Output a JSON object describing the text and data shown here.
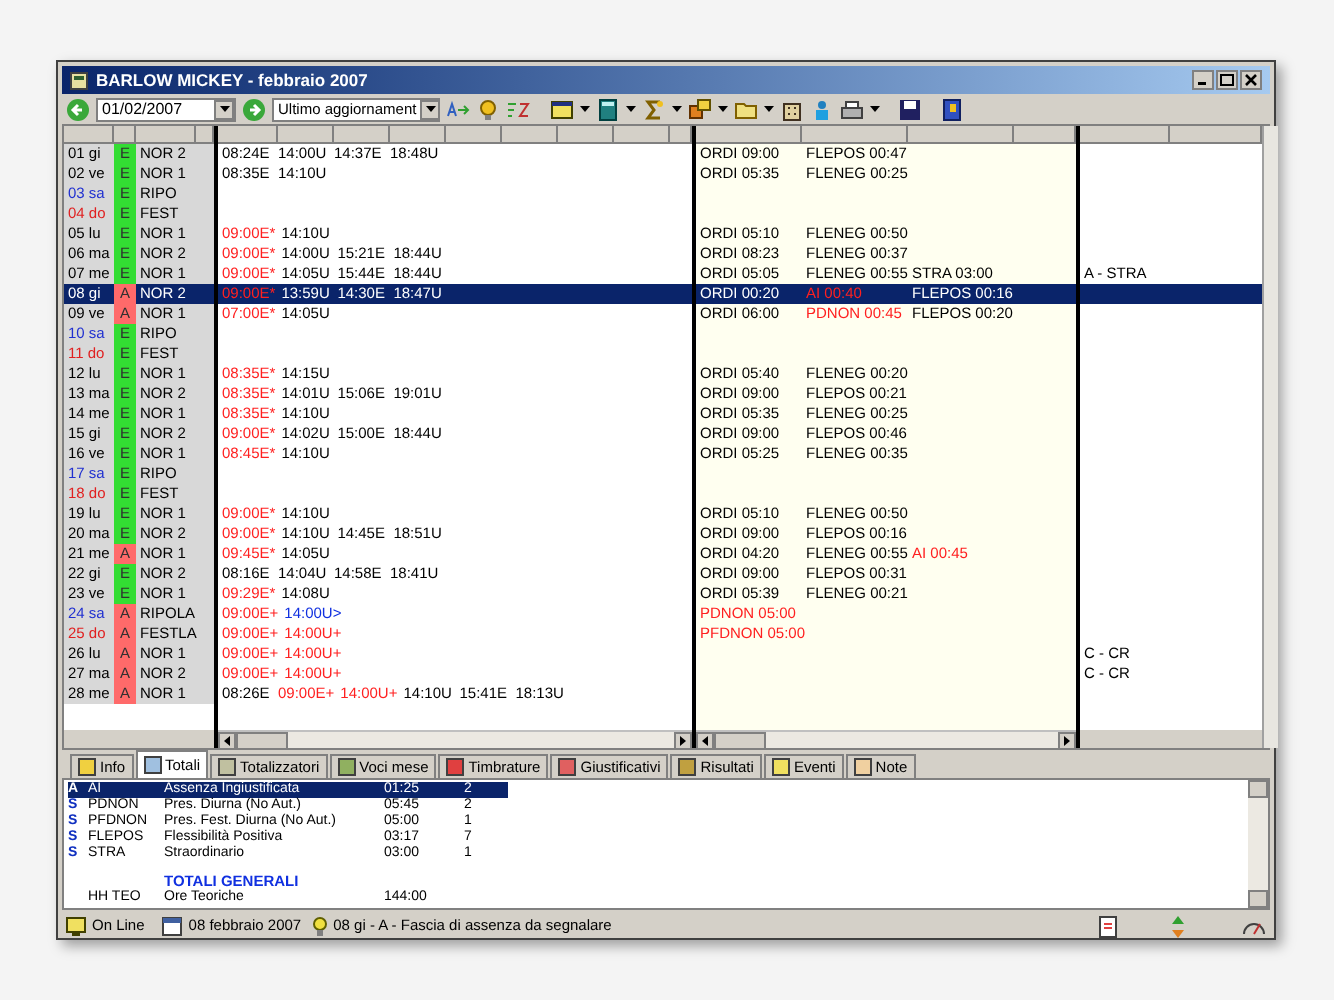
{
  "window": {
    "title": "BARLOW MICKEY - febbraio 2007"
  },
  "toolbar": {
    "date": "01/02/2007",
    "view": "Ultimo aggiornament"
  },
  "rows": [
    {
      "day": {
        "text": "01 gi",
        "color": "#000000"
      },
      "flag": {
        "text": "E",
        "color": "#33dd33"
      },
      "shift": "NOR 2",
      "selected": false,
      "times": [
        {
          "text": "08:24E",
          "kind": "normal"
        },
        {
          "text": "14:00U",
          "kind": "normal"
        },
        {
          "text": "14:37E",
          "kind": "normal"
        },
        {
          "text": "18:48U",
          "kind": "normal"
        }
      ],
      "results": [
        {
          "text": "ORDI 09:00",
          "kind": "normal"
        },
        {
          "text": "FLEPOS 00:47",
          "kind": "normal"
        }
      ]
    },
    {
      "day": {
        "text": "02 ve",
        "color": "#000000"
      },
      "flag": {
        "text": "E",
        "color": "#33dd33"
      },
      "shift": "NOR 1",
      "selected": false,
      "times": [
        {
          "text": "08:35E",
          "kind": "normal"
        },
        {
          "text": "14:10U",
          "kind": "normal"
        }
      ],
      "results": [
        {
          "text": "ORDI 05:35",
          "kind": "normal"
        },
        {
          "text": "FLENEG 00:25",
          "kind": "normal"
        }
      ]
    },
    {
      "day": {
        "text": "03 sa",
        "color": "#2030d0"
      },
      "flag": {
        "text": "E",
        "color": "#33dd33"
      },
      "shift": "RIPO",
      "selected": false,
      "times": [],
      "results": []
    },
    {
      "day": {
        "text": "04 do",
        "color": "#e02020"
      },
      "flag": {
        "text": "E",
        "color": "#33dd33"
      },
      "shift": "FEST",
      "selected": false,
      "times": [],
      "results": []
    },
    {
      "day": {
        "text": "05 lu",
        "color": "#000000"
      },
      "flag": {
        "text": "E",
        "color": "#33dd33"
      },
      "shift": "NOR 1",
      "selected": false,
      "times": [
        {
          "text": "09:00E*",
          "kind": "anomaly"
        },
        {
          "text": "14:10U",
          "kind": "normal"
        }
      ],
      "results": [
        {
          "text": "ORDI 05:10",
          "kind": "normal"
        },
        {
          "text": "FLENEG 00:50",
          "kind": "normal"
        }
      ]
    },
    {
      "day": {
        "text": "06 ma",
        "color": "#000000"
      },
      "flag": {
        "text": "E",
        "color": "#33dd33"
      },
      "shift": "NOR 2",
      "selected": false,
      "times": [
        {
          "text": "09:00E*",
          "kind": "anomaly"
        },
        {
          "text": "14:00U",
          "kind": "normal"
        },
        {
          "text": "15:21E",
          "kind": "normal"
        },
        {
          "text": "18:44U",
          "kind": "normal"
        }
      ],
      "results": [
        {
          "text": "ORDI 08:23",
          "kind": "normal"
        },
        {
          "text": "FLENEG 00:37",
          "kind": "normal"
        }
      ]
    },
    {
      "day": {
        "text": "07 me",
        "color": "#000000"
      },
      "flag": {
        "text": "E",
        "color": "#33dd33"
      },
      "shift": "NOR 1",
      "selected": false,
      "times": [
        {
          "text": "09:00E*",
          "kind": "anomaly"
        },
        {
          "text": "14:05U",
          "kind": "normal"
        },
        {
          "text": "15:44E",
          "kind": "normal"
        },
        {
          "text": "18:44U",
          "kind": "normal"
        }
      ],
      "results": [
        {
          "text": "ORDI 05:05",
          "kind": "normal"
        },
        {
          "text": "FLENEG 00:55",
          "kind": "normal"
        },
        {
          "text": "STRA 03:00",
          "kind": "normal"
        }
      ],
      "note": "A - STRA"
    },
    {
      "day": {
        "text": "08 gi"
      },
      "flag": {
        "text": "A",
        "color": "#ff6a6a"
      },
      "shift": "NOR 2",
      "selected": true,
      "times": [
        {
          "text": "09:00E*",
          "kind": "anomaly"
        },
        {
          "text": "13:59U",
          "kind": "normal"
        },
        {
          "text": "14:30E",
          "kind": "normal"
        },
        {
          "text": "18:47U",
          "kind": "normal"
        }
      ],
      "results": [
        {
          "text": "ORDI 00:20",
          "kind": "normal"
        },
        {
          "text": "AI 00:40",
          "kind": "anomaly"
        },
        {
          "text": "FLEPOS 00:16",
          "kind": "normal"
        }
      ]
    },
    {
      "day": {
        "text": "09 ve",
        "color": "#000000"
      },
      "flag": {
        "text": "A",
        "color": "#ff6a6a"
      },
      "shift": "NOR 1",
      "selected": false,
      "times": [
        {
          "text": "07:00E*",
          "kind": "anomaly"
        },
        {
          "text": "14:05U",
          "kind": "normal"
        }
      ],
      "results": [
        {
          "text": "ORDI 06:00",
          "kind": "normal"
        },
        {
          "text": "PDNON 00:45",
          "kind": "anomaly"
        },
        {
          "text": "FLEPOS 00:20",
          "kind": "normal"
        }
      ]
    },
    {
      "day": {
        "text": "10 sa",
        "color": "#2030d0"
      },
      "flag": {
        "text": "E",
        "color": "#33dd33"
      },
      "shift": "RIPO",
      "selected": false,
      "times": [],
      "results": []
    },
    {
      "day": {
        "text": "11 do",
        "color": "#e02020"
      },
      "flag": {
        "text": "E",
        "color": "#33dd33"
      },
      "shift": "FEST",
      "selected": false,
      "times": [],
      "results": []
    },
    {
      "day": {
        "text": "12 lu",
        "color": "#000000"
      },
      "flag": {
        "text": "E",
        "color": "#33dd33"
      },
      "shift": "NOR 1",
      "selected": false,
      "times": [
        {
          "text": "08:35E*",
          "kind": "anomaly"
        },
        {
          "text": "14:15U",
          "kind": "normal"
        }
      ],
      "results": [
        {
          "text": "ORDI 05:40",
          "kind": "normal"
        },
        {
          "text": "FLENEG 00:20",
          "kind": "normal"
        }
      ]
    },
    {
      "day": {
        "text": "13 ma",
        "color": "#000000"
      },
      "flag": {
        "text": "E",
        "color": "#33dd33"
      },
      "shift": "NOR 2",
      "selected": false,
      "times": [
        {
          "text": "08:35E*",
          "kind": "anomaly"
        },
        {
          "text": "14:01U",
          "kind": "normal"
        },
        {
          "text": "15:06E",
          "kind": "normal"
        },
        {
          "text": "19:01U",
          "kind": "normal"
        }
      ],
      "results": [
        {
          "text": "ORDI 09:00",
          "kind": "normal"
        },
        {
          "text": "FLEPOS 00:21",
          "kind": "normal"
        }
      ]
    },
    {
      "day": {
        "text": "14 me",
        "color": "#000000"
      },
      "flag": {
        "text": "E",
        "color": "#33dd33"
      },
      "shift": "NOR 1",
      "selected": false,
      "times": [
        {
          "text": "08:35E*",
          "kind": "anomaly"
        },
        {
          "text": "14:10U",
          "kind": "normal"
        }
      ],
      "results": [
        {
          "text": "ORDI 05:35",
          "kind": "normal"
        },
        {
          "text": "FLENEG 00:25",
          "kind": "normal"
        }
      ]
    },
    {
      "day": {
        "text": "15 gi",
        "color": "#000000"
      },
      "flag": {
        "text": "E",
        "color": "#33dd33"
      },
      "shift": "NOR 2",
      "selected": false,
      "times": [
        {
          "text": "09:00E*",
          "kind": "anomaly"
        },
        {
          "text": "14:02U",
          "kind": "normal"
        },
        {
          "text": "15:00E",
          "kind": "normal"
        },
        {
          "text": "18:44U",
          "kind": "normal"
        }
      ],
      "results": [
        {
          "text": "ORDI 09:00",
          "kind": "normal"
        },
        {
          "text": "FLEPOS 00:46",
          "kind": "normal"
        }
      ]
    },
    {
      "day": {
        "text": "16 ve",
        "color": "#000000"
      },
      "flag": {
        "text": "E",
        "color": "#33dd33"
      },
      "shift": "NOR 1",
      "selected": false,
      "times": [
        {
          "text": "08:45E*",
          "kind": "anomaly"
        },
        {
          "text": "14:10U",
          "kind": "normal"
        }
      ],
      "results": [
        {
          "text": "ORDI 05:25",
          "kind": "normal"
        },
        {
          "text": "FLENEG 00:35",
          "kind": "normal"
        }
      ]
    },
    {
      "day": {
        "text": "17 sa",
        "color": "#2030d0"
      },
      "flag": {
        "text": "E",
        "color": "#33dd33"
      },
      "shift": "RIPO",
      "selected": false,
      "times": [],
      "results": []
    },
    {
      "day": {
        "text": "18 do",
        "color": "#e02020"
      },
      "flag": {
        "text": "E",
        "color": "#33dd33"
      },
      "shift": "FEST",
      "selected": false,
      "times": [],
      "results": []
    },
    {
      "day": {
        "text": "19 lu",
        "color": "#000000"
      },
      "flag": {
        "text": "E",
        "color": "#33dd33"
      },
      "shift": "NOR 1",
      "selected": false,
      "times": [
        {
          "text": "09:00E*",
          "kind": "anomaly"
        },
        {
          "text": "14:10U",
          "kind": "normal"
        }
      ],
      "results": [
        {
          "text": "ORDI 05:10",
          "kind": "normal"
        },
        {
          "text": "FLENEG 00:50",
          "kind": "normal"
        }
      ]
    },
    {
      "day": {
        "text": "20 ma",
        "color": "#000000"
      },
      "flag": {
        "text": "E",
        "color": "#33dd33"
      },
      "shift": "NOR 2",
      "selected": false,
      "times": [
        {
          "text": "09:00E*",
          "kind": "anomaly"
        },
        {
          "text": "14:10U",
          "kind": "normal"
        },
        {
          "text": "14:45E",
          "kind": "normal"
        },
        {
          "text": "18:51U",
          "kind": "normal"
        }
      ],
      "results": [
        {
          "text": "ORDI 09:00",
          "kind": "normal"
        },
        {
          "text": "FLEPOS 00:16",
          "kind": "normal"
        }
      ]
    },
    {
      "day": {
        "text": "21 me",
        "color": "#000000"
      },
      "flag": {
        "text": "A",
        "color": "#ff6a6a"
      },
      "shift": "NOR 1",
      "selected": false,
      "times": [
        {
          "text": "09:45E*",
          "kind": "anomaly"
        },
        {
          "text": "14:05U",
          "kind": "normal"
        }
      ],
      "results": [
        {
          "text": "ORDI 04:20",
          "kind": "normal"
        },
        {
          "text": "FLENEG 00:55",
          "kind": "normal"
        },
        {
          "text": "AI 00:45",
          "kind": "anomaly"
        }
      ]
    },
    {
      "day": {
        "text": "22 gi",
        "color": "#000000"
      },
      "flag": {
        "text": "E",
        "color": "#33dd33"
      },
      "shift": "NOR 2",
      "selected": false,
      "times": [
        {
          "text": "08:16E",
          "kind": "normal"
        },
        {
          "text": "14:04U",
          "kind": "normal"
        },
        {
          "text": "14:58E",
          "kind": "normal"
        },
        {
          "text": "18:41U",
          "kind": "normal"
        }
      ],
      "results": [
        {
          "text": "ORDI 09:00",
          "kind": "normal"
        },
        {
          "text": "FLEPOS 00:31",
          "kind": "normal"
        }
      ]
    },
    {
      "day": {
        "text": "23 ve",
        "color": "#000000"
      },
      "flag": {
        "text": "E",
        "color": "#33dd33"
      },
      "shift": "NOR 1",
      "selected": false,
      "times": [
        {
          "text": "09:29E*",
          "kind": "anomaly"
        },
        {
          "text": "14:08U",
          "kind": "normal"
        }
      ],
      "results": [
        {
          "text": "ORDI 05:39",
          "kind": "normal"
        },
        {
          "text": "FLENEG 00:21",
          "kind": "normal"
        }
      ]
    },
    {
      "day": {
        "text": "24 sa",
        "color": "#2030d0"
      },
      "flag": {
        "text": "A",
        "color": "#ff6a6a"
      },
      "shift": "RIPOLA",
      "selected": false,
      "times": [
        {
          "text": "09:00E+",
          "kind": "anomaly"
        },
        {
          "text": "14:00U>",
          "kind": "forced"
        }
      ],
      "results": [
        {
          "text": "PDNON 05:00",
          "kind": "anomaly"
        }
      ]
    },
    {
      "day": {
        "text": "25 do",
        "color": "#e02020"
      },
      "flag": {
        "text": "A",
        "color": "#ff6a6a"
      },
      "shift": "FESTLA",
      "selected": false,
      "times": [
        {
          "text": "09:00E+",
          "kind": "anomaly"
        },
        {
          "text": "14:00U+",
          "kind": "anomaly"
        }
      ],
      "results": [
        {
          "text": "PFDNON 05:00",
          "kind": "anomaly"
        }
      ]
    },
    {
      "day": {
        "text": "26 lu",
        "color": "#000000"
      },
      "flag": {
        "text": "A",
        "color": "#ff6a6a"
      },
      "shift": "NOR 1",
      "selected": false,
      "times": [
        {
          "text": "09:00E+",
          "kind": "anomaly"
        },
        {
          "text": "14:00U+",
          "kind": "anomaly"
        }
      ],
      "results": [],
      "note": "C - CR"
    },
    {
      "day": {
        "text": "27 ma",
        "color": "#000000"
      },
      "flag": {
        "text": "A",
        "color": "#ff6a6a"
      },
      "shift": "NOR 2",
      "selected": false,
      "times": [
        {
          "text": "09:00E+",
          "kind": "anomaly"
        },
        {
          "text": "14:00U+",
          "kind": "anomaly"
        }
      ],
      "results": [],
      "note": "C - CR"
    },
    {
      "day": {
        "text": "28 me",
        "color": "#000000"
      },
      "flag": {
        "text": "A",
        "color": "#ff6a6a"
      },
      "shift": "NOR 1",
      "selected": false,
      "times": [
        {
          "text": "08:26E",
          "kind": "normal"
        },
        {
          "text": "09:00E+",
          "kind": "anomaly"
        },
        {
          "text": "14:00U+",
          "kind": "anomaly"
        },
        {
          "text": "14:10U",
          "kind": "normal"
        },
        {
          "text": "15:41E",
          "kind": "normal"
        },
        {
          "text": "18:13U",
          "kind": "normal"
        }
      ],
      "results": []
    }
  ],
  "tabs": [
    {
      "label": "Info",
      "selected": false
    },
    {
      "label": "Totali",
      "selected": true
    },
    {
      "label": "Totalizzatori",
      "selected": false
    },
    {
      "label": "Voci mese",
      "selected": false
    },
    {
      "label": "Timbrature",
      "selected": false
    },
    {
      "label": "Giustificativi",
      "selected": false
    },
    {
      "label": "Risultati",
      "selected": false
    },
    {
      "label": "Eventi",
      "selected": false
    },
    {
      "label": "Note",
      "selected": false
    }
  ],
  "totals": [
    {
      "type": "A",
      "code": "AI",
      "description": "Assenza Ingiustificata",
      "time": "01:25",
      "count": "2",
      "selected": true
    },
    {
      "type": "S",
      "code": "PDNON",
      "description": "Pres. Diurna (No Aut.)",
      "time": "05:45",
      "count": "2",
      "selected": false
    },
    {
      "type": "S",
      "code": "PFDNON",
      "description": "Pres. Fest. Diurna (No Aut.)",
      "time": "05:00",
      "count": "1",
      "selected": false
    },
    {
      "type": "S",
      "code": "FLEPOS",
      "description": "Flessibilità Positiva",
      "time": "03:17",
      "count": "7",
      "selected": false
    },
    {
      "type": "S",
      "code": "STRA",
      "description": "Straordinario",
      "time": "03:00",
      "count": "1",
      "selected": false
    }
  ],
  "general_totals": {
    "heading": "TOTALI GENERALI",
    "rows": [
      {
        "code": "HH TEO",
        "description": "Ore Teoriche",
        "time": "144:00"
      }
    ]
  },
  "status_bar": {
    "connection": "On Line",
    "date": "08 febbraio 2007",
    "message": "08 gi - A - Fascia di assenza da segnalare"
  }
}
